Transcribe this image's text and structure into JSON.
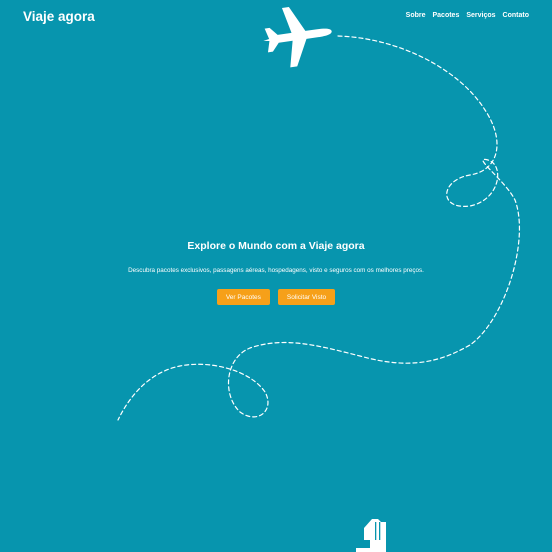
{
  "header": {
    "brand": "Viaje agora",
    "nav": {
      "about": "Sobre",
      "packages": "Pacotes",
      "services": "Serviços",
      "contact": "Contato"
    }
  },
  "hero": {
    "title": "Explore o Mundo com a Viaje agora",
    "subtitle": "Descubra pacotes exclusivos, passagens aéreas, hospedagens, visto e seguros com os melhores preços.",
    "primary_button": "Ver Pacotes",
    "secondary_button": "Solicitar Visto"
  },
  "colors": {
    "background": "#0795ae",
    "accent": "#f6a019",
    "text": "#ffffff"
  },
  "icons": {
    "airplane": "airplane-icon",
    "flight_path": "dashed-flight-path",
    "building": "building-icon"
  }
}
